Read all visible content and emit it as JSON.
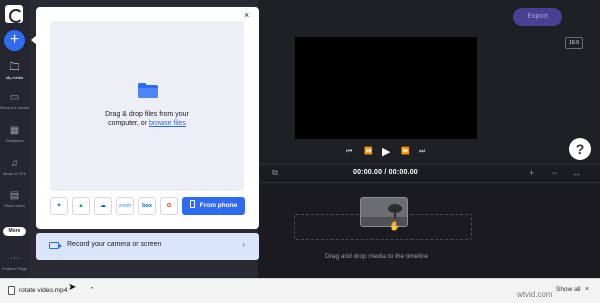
{
  "sidebar": {
    "items": [
      {
        "label": "My media",
        "glyph": "🗀"
      },
      {
        "label": "Record & create",
        "glyph": "▭"
      },
      {
        "label": "Templates",
        "glyph": "▦"
      },
      {
        "label": "Music & SFX",
        "glyph": "♫"
      },
      {
        "label": "Stock video",
        "glyph": "▤"
      },
      {
        "label": "Feature Flags",
        "glyph": "⋯"
      }
    ],
    "more_label": "More"
  },
  "toolbar": {
    "export_label": "Export",
    "ratio_label": "16:9"
  },
  "player": {
    "controls": [
      "⏮",
      "⏪",
      "▶",
      "⏩",
      "⏭"
    ],
    "help_label": "?"
  },
  "timeline": {
    "timecode": "00:00.00 / 00:00.00",
    "drop_hint": "Drag and drop media to the timeline",
    "zoom_in": "+",
    "zoom_out": "−",
    "fit": "↔"
  },
  "upload": {
    "drop_text_line1": "Drag & drop files from your",
    "drop_text_line2": "computer, or",
    "browse_link": "browse files",
    "sources": [
      {
        "name": "dropbox",
        "label": "✦"
      },
      {
        "name": "google-drive",
        "label": "▲"
      },
      {
        "name": "onedrive",
        "label": "☁"
      },
      {
        "name": "zoom",
        "label": "zoom"
      },
      {
        "name": "box",
        "label": "box"
      },
      {
        "name": "google-photos",
        "label": "✿"
      }
    ],
    "from_phone_label": "From phone",
    "record_label": "Record your camera or screen",
    "close_label": "×"
  },
  "download_bar": {
    "file_name": "rotate video.mp4",
    "show_all": "Show all",
    "close": "×"
  },
  "watermark": "wtvid.com",
  "colors": {
    "accent": "#2f6bf2",
    "export_bg": "#4a3f92",
    "record_bg": "#dbe5fa"
  }
}
